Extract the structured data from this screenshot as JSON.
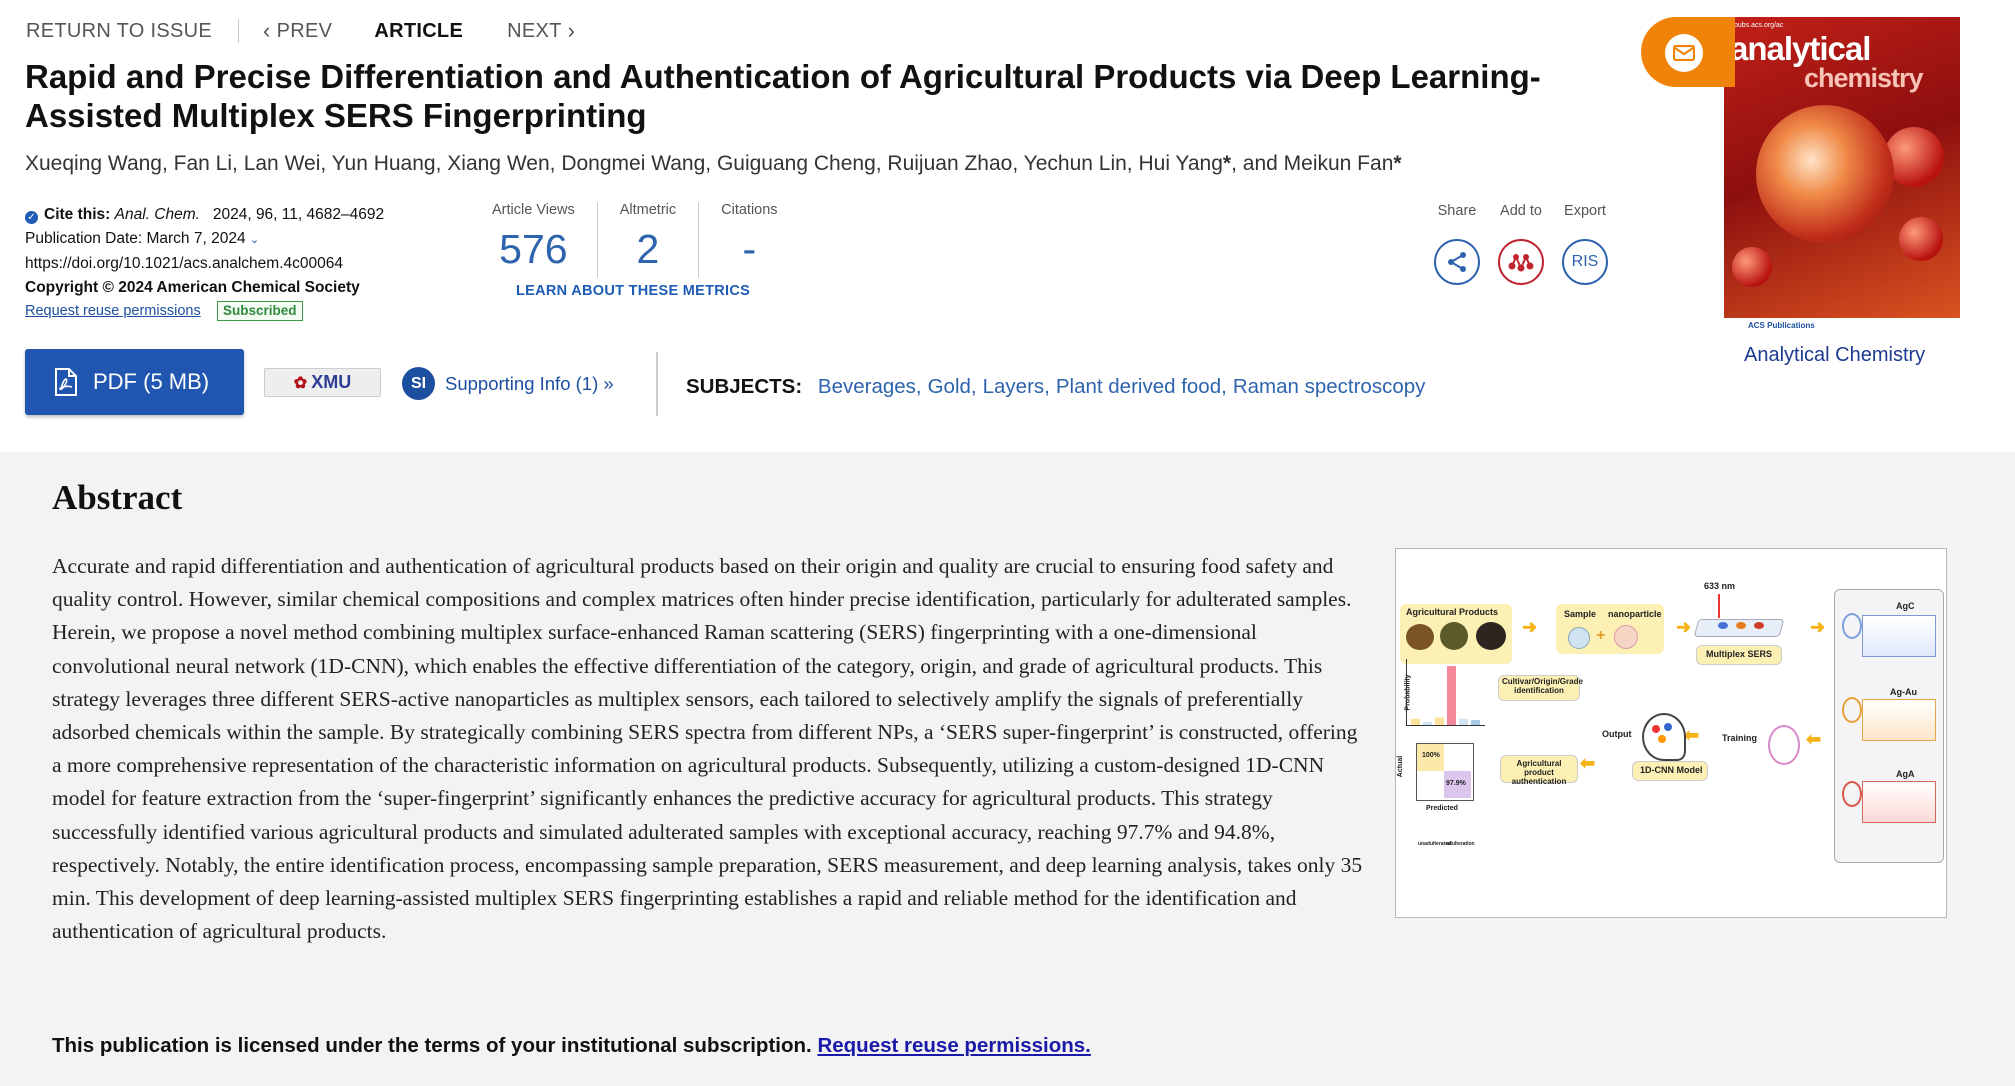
{
  "nav": {
    "return_label": "RETURN TO ISSUE",
    "prev_label": "PREV",
    "article_label": "ARTICLE",
    "next_label": "NEXT"
  },
  "article": {
    "title": "Rapid and Precise Differentiation and Authentication of Agricultural Products via Deep Learning-Assisted Multiplex SERS Fingerprinting",
    "authors": [
      {
        "name": "Xueqing Wang",
        "sep": ", "
      },
      {
        "name": "Fan Li",
        "sep": ", "
      },
      {
        "name": "Lan Wei",
        "sep": ", "
      },
      {
        "name": "Yun Huang",
        "sep": ", "
      },
      {
        "name": "Xiang Wen",
        "sep": ", "
      },
      {
        "name": "Dongmei Wang",
        "sep": ", "
      },
      {
        "name": "Guiguang Cheng",
        "sep": ", "
      },
      {
        "name": "Ruijuan Zhao",
        "sep": ", "
      },
      {
        "name": "Yechun Lin",
        "sep": ", "
      },
      {
        "name": "Hui Yang",
        "corr": "*",
        "sep": ", and "
      },
      {
        "name": "Meikun Fan",
        "corr": "*",
        "sep": ""
      }
    ]
  },
  "meta": {
    "cite_label": "Cite this:",
    "journal_abbrev": "Anal. Chem.",
    "citation": "2024, 96, 11, 4682–4692",
    "pub_date": "Publication Date: March 7, 2024",
    "doi": "https://doi.org/10.1021/acs.analchem.4c00064",
    "copyright": "Copyright © 2024 American Chemical Society",
    "reuse_label": "Request reuse permissions",
    "subscribed_badge": "Subscribed"
  },
  "metrics": {
    "views_label": "Article Views",
    "views_value": "576",
    "altmetric_label": "Altmetric",
    "altmetric_value": "2",
    "citations_label": "Citations",
    "citations_value": "-",
    "learn_label": "LEARN ABOUT THESE METRICS"
  },
  "tools": {
    "share_label": "Share",
    "add_label": "Add to",
    "export_label": "Export",
    "export_button": "RIS"
  },
  "cover": {
    "top_text": "pubs.acs.org/ac",
    "journal_line1": "analytical",
    "journal_line2": "chemistry",
    "footer_text": "ACS Publications"
  },
  "journal_link": "Analytical Chemistry",
  "actions": {
    "pdf_label": "PDF (5 MB)",
    "xmu_label": "XMU",
    "si_badge": "SI",
    "si_label": "Supporting Info (1) »"
  },
  "subjects": {
    "heading": "SUBJECTS:",
    "items": [
      "Beverages",
      "Gold",
      "Layers",
      "Plant derived food",
      "Raman spectroscopy"
    ]
  },
  "abstract": {
    "heading": "Abstract",
    "text": "Accurate and rapid differentiation and authentication of agricultural products based on their origin and quality are crucial to ensuring food safety and quality control. However, similar chemical compositions and complex matrices often hinder precise identification, particularly for adulterated samples. Herein, we propose a novel method combining multiplex surface-enhanced Raman scattering (SERS) fingerprinting with a one-dimensional convolutional neural network (1D-CNN), which enables the effective differentiation of the category, origin, and grade of agricultural products. This strategy leverages three different SERS-active nanoparticles as multiplex sensors, each tailored to selectively amplify the signals of preferentially adsorbed chemicals within the sample. By strategically combining SERS spectra from different NPs, a ‘SERS super-fingerprint’ is constructed, offering a more comprehensive representation of the characteristic information on agricultural products. Subsequently, utilizing a custom-designed 1D-CNN model for feature extraction from the ‘super-fingerprint’ significantly enhances the predictive accuracy for agricultural products. This strategy successfully identified various agricultural products and simulated adulterated samples with exceptional accuracy, reaching 97.7% and 94.8%, respectively. Notably, the entire identification process, encompassing sample preparation, SERS measurement, and deep learning analysis, takes only 35 min. This development of deep learning-assisted multiplex SERS fingerprinting establishes a rapid and reliable method for the identification and authentication of agricultural products.",
    "license_text": "This publication is licensed under the terms of your institutional subscription.",
    "license_link": "Request reuse permissions."
  },
  "toc_graphic": {
    "agri_label": "Agricultural Products",
    "sample_label": "Sample",
    "nanoparticle_label": "nanoparticle",
    "laser_label": "633 nm",
    "multiplex_label": "Multiplex SERS",
    "cultivar_label": "Cultivar/Origin/Grade identification",
    "probability_label": "Probability",
    "output_label": "Output",
    "training_label": "Training",
    "auth_label": "Agricultural product authentication",
    "cnn_label": "1D-CNN Model",
    "agc_label": "AgC",
    "agau_label": "Ag-Au",
    "aga_label": "AgA",
    "actual_label": "Actual",
    "predicted_label": "Predicted",
    "cm_top": "100%",
    "cm_bottom": "97.9%",
    "unadulterated_label": "unadulterated",
    "adulteration_label": "adulteration",
    "bar_heights": [
      0.1,
      0.05,
      0.12,
      0.95,
      0.1,
      0.08
    ]
  }
}
